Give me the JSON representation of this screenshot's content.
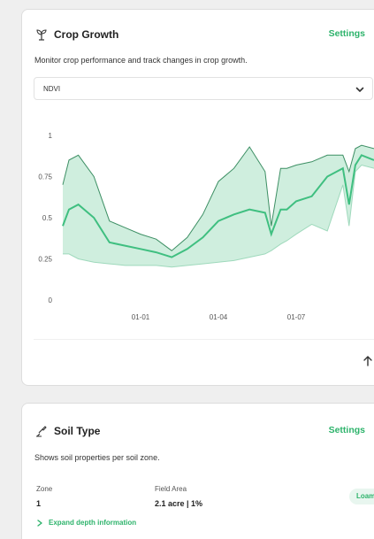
{
  "crop_card": {
    "title": "Crop Growth",
    "settings_label": "Settings",
    "description": "Monitor crop performance and track changes in crop growth.",
    "select_value": "NDVI",
    "icon": "sprout-icon"
  },
  "soil_card": {
    "title": "Soil Type",
    "settings_label": "Settings",
    "description": "Shows soil properties per soil zone.",
    "icon": "shovel-icon",
    "zone_label": "Zone",
    "zone_value": "1",
    "area_label": "Field Area",
    "area_value": "2.1 acre | 1%",
    "soil_badge": "Loam",
    "expand_label": "Expand depth information"
  },
  "colors": {
    "accent": "#2db36b",
    "line": "#3fbf80",
    "band": "#bfe8d3"
  },
  "chart_data": {
    "type": "area",
    "ylim": [
      0,
      1
    ],
    "yticks": [
      "0",
      "0.25",
      "0.5",
      "0.75",
      "1"
    ],
    "xticks": [
      "01-01",
      "01-04",
      "01-07"
    ],
    "xlim": [
      0,
      1
    ],
    "series": [
      {
        "role": "mean",
        "x": [
          0.0,
          0.02,
          0.05,
          0.1,
          0.15,
          0.2,
          0.25,
          0.3,
          0.35,
          0.4,
          0.45,
          0.5,
          0.55,
          0.6,
          0.65,
          0.67,
          0.7,
          0.72,
          0.75,
          0.8,
          0.85,
          0.9,
          0.92,
          0.94,
          0.96,
          1.0
        ],
        "y": [
          0.45,
          0.55,
          0.58,
          0.5,
          0.35,
          0.33,
          0.31,
          0.29,
          0.26,
          0.31,
          0.38,
          0.48,
          0.52,
          0.55,
          0.53,
          0.4,
          0.55,
          0.55,
          0.6,
          0.63,
          0.75,
          0.8,
          0.58,
          0.82,
          0.88,
          0.85
        ]
      },
      {
        "role": "upper",
        "x": [
          0.0,
          0.02,
          0.05,
          0.1,
          0.15,
          0.2,
          0.25,
          0.3,
          0.35,
          0.4,
          0.45,
          0.5,
          0.55,
          0.6,
          0.65,
          0.67,
          0.7,
          0.72,
          0.75,
          0.8,
          0.85,
          0.9,
          0.92,
          0.94,
          0.96,
          1.0
        ],
        "y": [
          0.7,
          0.85,
          0.88,
          0.75,
          0.48,
          0.44,
          0.4,
          0.37,
          0.3,
          0.38,
          0.52,
          0.72,
          0.8,
          0.93,
          0.78,
          0.45,
          0.8,
          0.8,
          0.82,
          0.84,
          0.88,
          0.88,
          0.78,
          0.92,
          0.94,
          0.92
        ]
      },
      {
        "role": "lower",
        "x": [
          0.0,
          0.02,
          0.05,
          0.1,
          0.15,
          0.2,
          0.25,
          0.3,
          0.35,
          0.4,
          0.45,
          0.5,
          0.55,
          0.6,
          0.65,
          0.67,
          0.7,
          0.72,
          0.75,
          0.8,
          0.85,
          0.9,
          0.92,
          0.94,
          0.96,
          1.0
        ],
        "y": [
          0.28,
          0.28,
          0.25,
          0.23,
          0.22,
          0.21,
          0.21,
          0.21,
          0.2,
          0.21,
          0.22,
          0.23,
          0.24,
          0.26,
          0.28,
          0.3,
          0.34,
          0.36,
          0.4,
          0.46,
          0.42,
          0.7,
          0.45,
          0.78,
          0.82,
          0.8
        ]
      }
    ]
  }
}
